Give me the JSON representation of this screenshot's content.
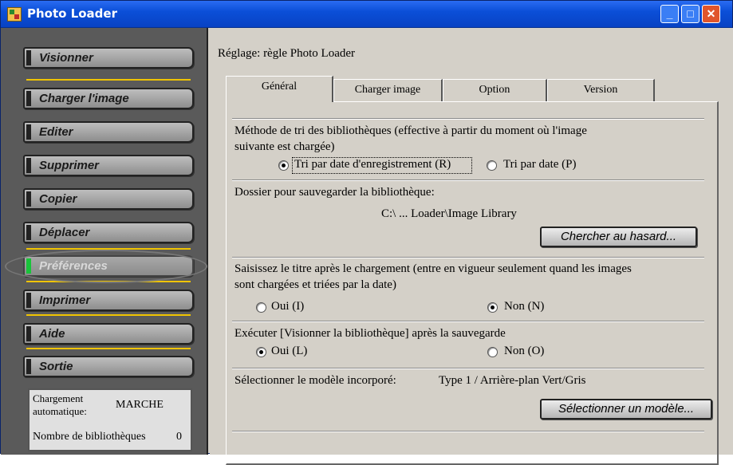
{
  "window": {
    "title": "Photo Loader",
    "minimize_glyph": "_",
    "maximize_glyph": "□",
    "close_glyph": "✕"
  },
  "sidebar": {
    "items": [
      {
        "label": "Visionner",
        "enabled": true
      },
      {
        "label": "Charger l'image",
        "enabled": true
      },
      {
        "label": "Editer",
        "enabled": true
      },
      {
        "label": "Supprimer",
        "enabled": true
      },
      {
        "label": "Copier",
        "enabled": true
      },
      {
        "label": "Déplacer",
        "enabled": true
      },
      {
        "label": "Préférences",
        "enabled": false
      },
      {
        "label": "Imprimer",
        "enabled": true
      },
      {
        "label": "Aide",
        "enabled": true
      },
      {
        "label": "Sortie",
        "enabled": true
      }
    ],
    "status": {
      "auto_load_label_1": "Chargement",
      "auto_load_label_2": "automatique:",
      "auto_load_value": "MARCHE",
      "library_count_label": "Nombre de bibliothèques",
      "library_count_value": "0"
    }
  },
  "settings": {
    "heading": "Réglage: règle Photo Loader",
    "tabs": [
      {
        "label": "Général",
        "active": true
      },
      {
        "label": "Charger image",
        "active": false
      },
      {
        "label": "Option",
        "active": false
      },
      {
        "label": "Version",
        "active": false
      }
    ],
    "sort": {
      "label_line1": "Méthode de tri des bibliothèques (effective à partir du moment où l'image",
      "label_line2": "suivante est chargée)",
      "opt1": "Tri par date d'enregistrement (R)",
      "opt2": "Tri par date (P)",
      "selected": "opt1"
    },
    "folder": {
      "label": "Dossier pour sauvegarder la bibliothèque:",
      "path": "C:\\ ... Loader\\Image Library",
      "button": "Chercher au hasard..."
    },
    "title_after_load": {
      "label_line1": "Saisissez le titre après le chargement (entre en vigueur seulement quand les images",
      "label_line2": "sont chargées et triées par la date)",
      "yes": "Oui (I)",
      "no": "Non (N)",
      "selected": "no"
    },
    "run_view": {
      "label": "Exécuter [Visionner la bibliothèque] après la sauvegarde",
      "yes": "Oui (L)",
      "no": "Non (O)",
      "selected": "yes"
    },
    "model": {
      "label": "Sélectionner le modèle incorporé:",
      "value": "Type 1 / Arrière-plan Vert/Gris",
      "button": "Sélectionner un modèle..."
    }
  },
  "colors": {
    "sidebar_bg": "#5a5a5a",
    "divider_yellow": "#f0c400",
    "disabled_marker": "#19c43a",
    "titlebar_blue": "#0b4fd8"
  }
}
